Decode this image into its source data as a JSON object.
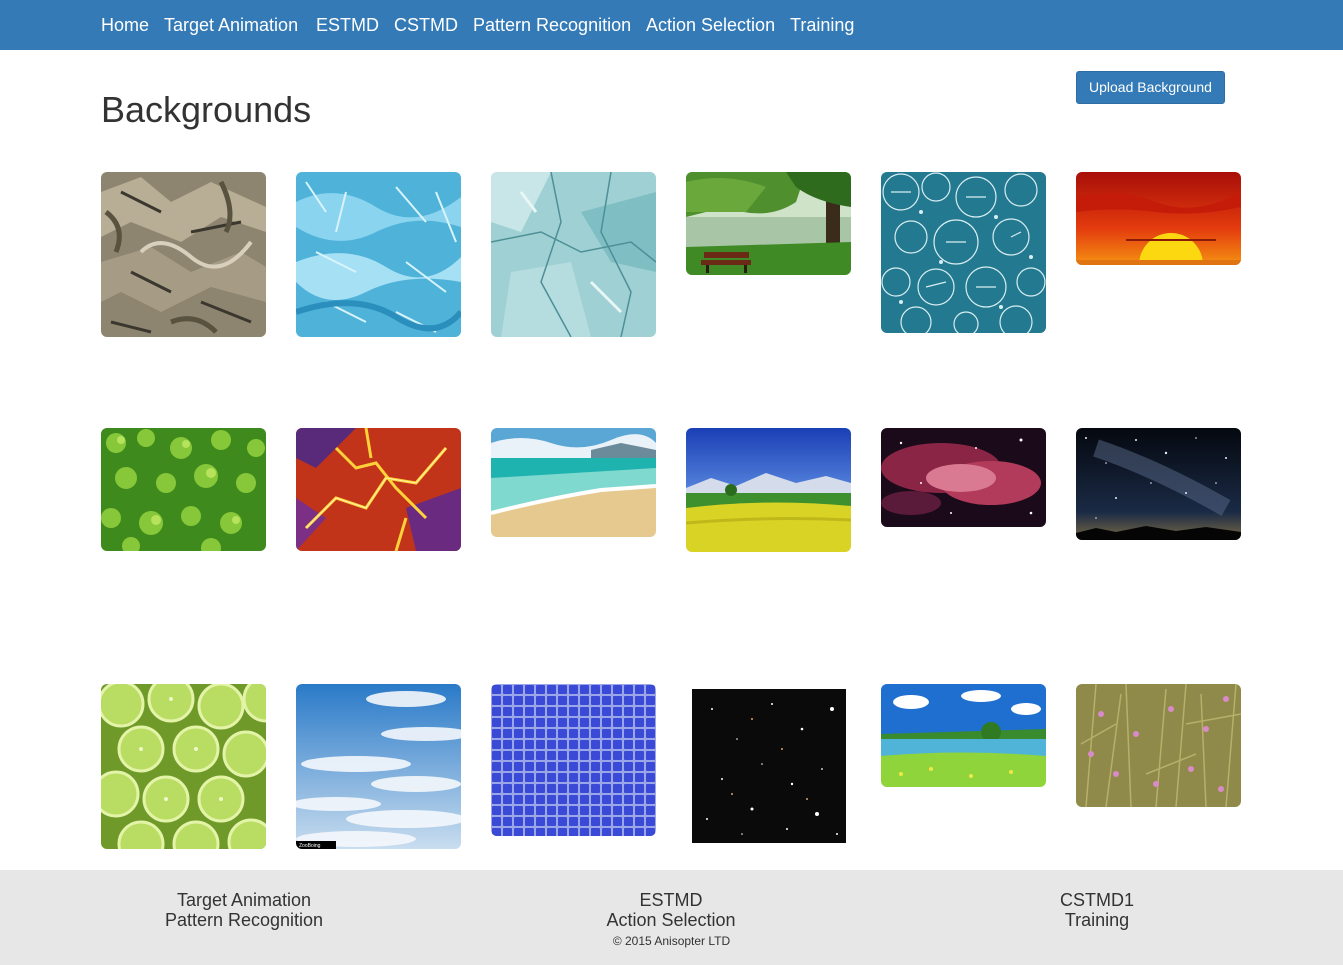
{
  "nav": {
    "items": [
      "Home",
      "Target Animation",
      "ESTMD",
      "CSTMD",
      "Pattern Recognition",
      "Action Selection",
      "Training"
    ]
  },
  "page": {
    "title": "Backgrounds",
    "upload_label": "Upload Background"
  },
  "gallery": [
    "rocky-stone-texture",
    "blue-ice-crystal-texture",
    "teal-marble-texture",
    "park-bench-by-lake",
    "teal-balloon-pattern",
    "red-sunset",
    "green-shrub-leaves",
    "orange-fractal-fire",
    "tropical-beach",
    "yellow-flower-field",
    "pink-nebula",
    "milky-way-night-sky",
    "lime-slices",
    "blue-sky-clouds",
    "blue-mosaic-tiles",
    "starfield",
    "lake-meadow-landscape",
    "wildflower-grass"
  ],
  "gallery_watermark": "ZooBoing",
  "footer": {
    "col1": [
      "Target Animation",
      "Pattern Recognition"
    ],
    "col2": [
      "ESTMD",
      "Action Selection"
    ],
    "col3": [
      "CSTMD1",
      "Training"
    ],
    "copyright": "© 2015 Anisopter LTD"
  },
  "colors": {
    "navbar": "#337ab7",
    "footer": "#e7e7e7",
    "button": "#337ab7"
  }
}
